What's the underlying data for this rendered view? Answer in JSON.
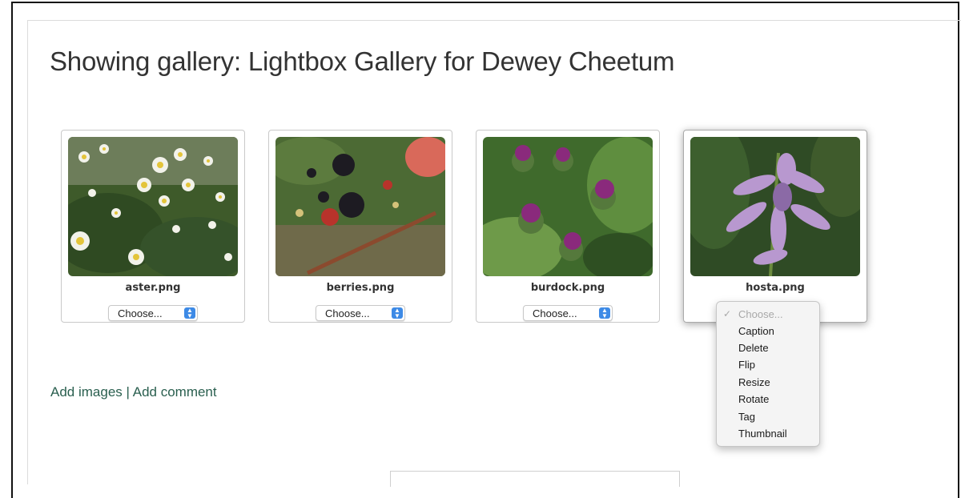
{
  "page": {
    "title": "Showing gallery: Lightbox Gallery for Dewey Cheetum"
  },
  "gallery": {
    "items": [
      {
        "filename": "aster.png",
        "action_value": "Choose...",
        "image_subject": "aster flowers"
      },
      {
        "filename": "berries.png",
        "action_value": "Choose...",
        "image_subject": "blackberries"
      },
      {
        "filename": "burdock.png",
        "action_value": "Choose...",
        "image_subject": "burdock flowers"
      },
      {
        "filename": "hosta.png",
        "action_value": "Choose...",
        "image_subject": "hosta flowers"
      }
    ]
  },
  "dropdown": {
    "selected": "Choose...",
    "options": [
      "Caption",
      "Delete",
      "Flip",
      "Resize",
      "Rotate",
      "Tag",
      "Thumbnail"
    ]
  },
  "footer_links": {
    "add_images": "Add images",
    "separator": "|",
    "add_comment": "Add comment"
  },
  "colors": {
    "link": "#2a5f4f",
    "select_accent": "#3d8ae6",
    "title": "#333333"
  }
}
